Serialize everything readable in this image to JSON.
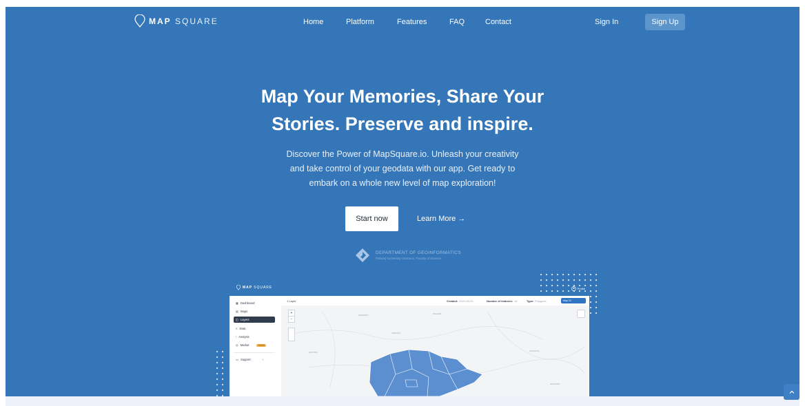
{
  "brand": {
    "name_bold": "MAP",
    "name_light": "SQUARE"
  },
  "nav": {
    "items": [
      {
        "label": "Home"
      },
      {
        "label": "Platform"
      },
      {
        "label": "Features"
      },
      {
        "label": "FAQ"
      },
      {
        "label": "Contact"
      }
    ],
    "sign_in": "Sign In",
    "sign_up": "Sign Up"
  },
  "hero": {
    "headline_line1": "Map Your Memories, Share Your",
    "headline_line2": "Stories. Preserve and inspire.",
    "sub_line1": "Discover the Power of MapSquare.io. Unleash your creativity",
    "sub_line2": "and take control of your geodata with our app. Get ready to",
    "sub_line3": "embark on a whole new level of map exploration!",
    "start_button": "Start now",
    "learn_more": "Learn More →"
  },
  "partner": {
    "name": "DEPARTMENT OF GEOINFORMATICS",
    "sub": "Palacký University Olomouc, Faculty of Science"
  },
  "mock_app": {
    "logo_bold": "MAP",
    "logo_light": "SQUARE",
    "profile": "Profile",
    "sidebar": [
      {
        "label": "Dashboard"
      },
      {
        "label": "Maps"
      },
      {
        "label": "Layers"
      },
      {
        "label": "Data"
      },
      {
        "label": "Analysis"
      },
      {
        "label": "Market"
      },
      {
        "label": "Support"
      }
    ],
    "market_badge": "SOON",
    "header": {
      "layer_title": "1 Layer",
      "created_label": "Created:",
      "created_value": "2023-08-20",
      "features_label": "Number of features:",
      "features_value": "14",
      "type_label": "Type:",
      "type_value": "Polygons",
      "select_value": "Map 24"
    },
    "map_labels": [
      "GERMANY",
      "POLAND",
      "AUSTRIA",
      "SLOVAKIA",
      "HUNGARY",
      "CZECHIA"
    ]
  },
  "colors": {
    "hero_bg": "#3576b8",
    "button_primary": "#5c95cc",
    "map_fill": "#5b8fd0"
  }
}
